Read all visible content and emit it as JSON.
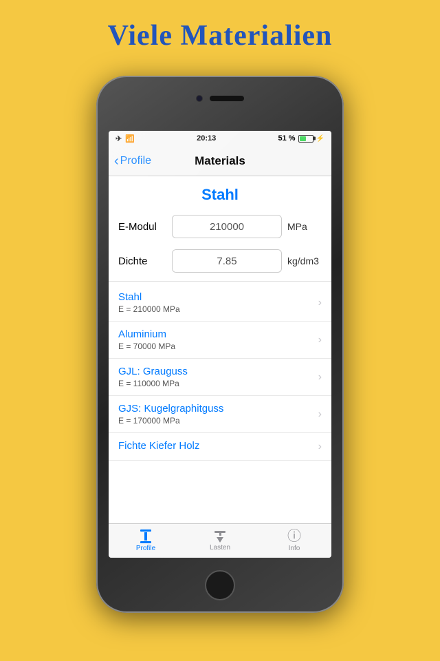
{
  "page": {
    "background_title": "Viele Materialien",
    "status_bar": {
      "time": "20:13",
      "battery_text": "51 %",
      "signal_icon": "wifi-icon",
      "airplane_icon": "airplane-icon"
    },
    "nav": {
      "back_label": "Profile",
      "title": "Materials"
    },
    "material": {
      "name": "Stahl",
      "fields": [
        {
          "label": "E-Modul",
          "value": "210000",
          "unit": "MPa"
        },
        {
          "label": "Dichte",
          "value": "7.85",
          "unit": "kg/dm3"
        }
      ]
    },
    "material_list": [
      {
        "name": "Stahl",
        "desc": "E = 210000 MPa"
      },
      {
        "name": "Aluminium",
        "desc": "E = 70000 MPa"
      },
      {
        "name": "GJL: Grauguss",
        "desc": "E = 110000 MPa"
      },
      {
        "name": "GJS: Kugelgraphitguss",
        "desc": "E = 170000 MPa"
      },
      {
        "name": "Fichte Kiefer Holz",
        "desc": ""
      }
    ],
    "tab_bar": {
      "tabs": [
        {
          "id": "profile",
          "label": "Profile",
          "active": true
        },
        {
          "id": "lasten",
          "label": "Lasten",
          "active": false
        },
        {
          "id": "info",
          "label": "Info",
          "active": false
        }
      ]
    }
  }
}
